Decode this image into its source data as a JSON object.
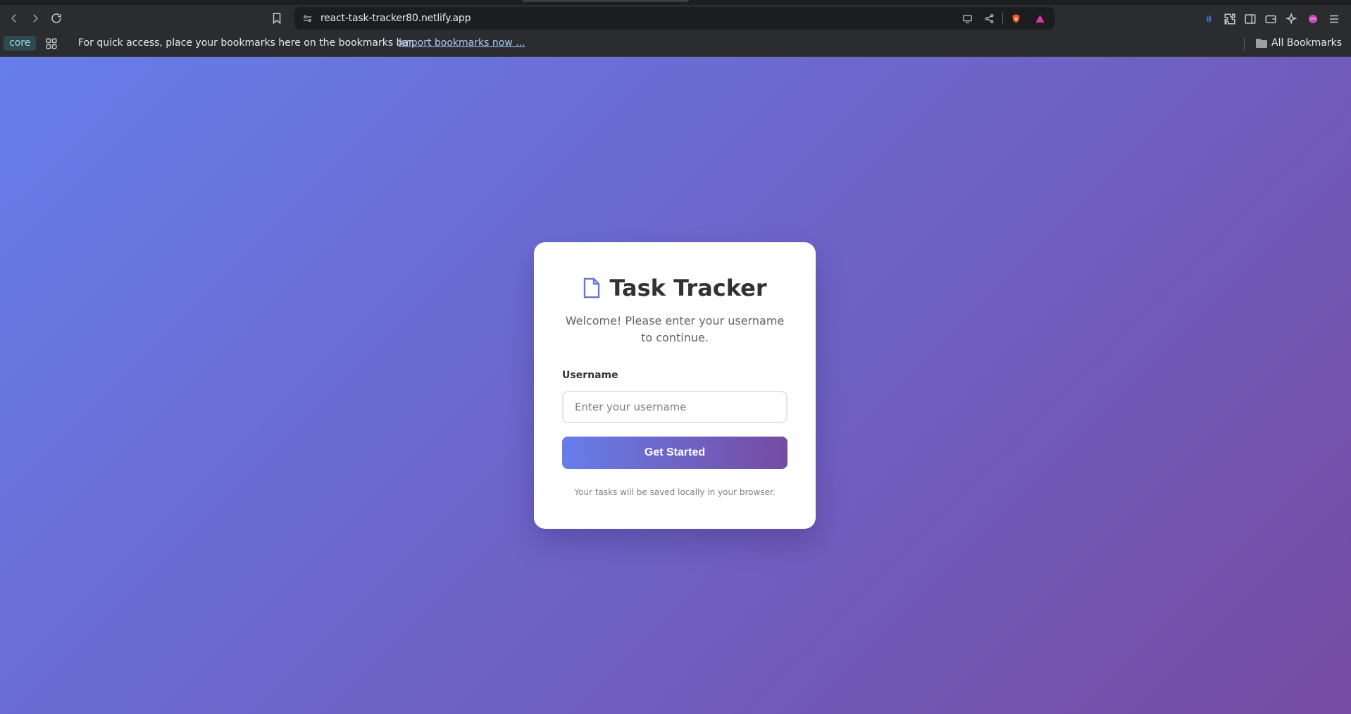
{
  "browser": {
    "url": "react-task-tracker80.netlify.app",
    "bookmarks_bar": {
      "profile_chip": "core",
      "message": "For quick access, place your bookmarks here on the bookmarks bar.",
      "import_link": "Import bookmarks now ...",
      "all_bookmarks": "All Bookmarks"
    }
  },
  "login": {
    "title": "Task Tracker",
    "subtitle": "Welcome! Please enter your username to continue.",
    "username_label": "Username",
    "username_placeholder": "Enter your username",
    "username_value": "",
    "submit_label": "Get Started",
    "footnote": "Your tasks will be saved locally in your browser."
  },
  "colors": {
    "gradient_start": "#667eea",
    "gradient_end": "#764ba2",
    "title_text": "#2f3336",
    "icon_accent": "#6a78dc"
  },
  "icons": [
    "back-icon",
    "forward-icon",
    "reload-icon",
    "bookmark-icon",
    "site-info-icon",
    "cast-icon",
    "share-icon",
    "brave-shield-icon",
    "brave-rewards-icon",
    "wallet-icon",
    "extensions-icon",
    "sidebar-icon",
    "leo-ai-icon",
    "profile-icon",
    "menu-icon",
    "apps-icon",
    "folder-icon",
    "document-icon"
  ]
}
